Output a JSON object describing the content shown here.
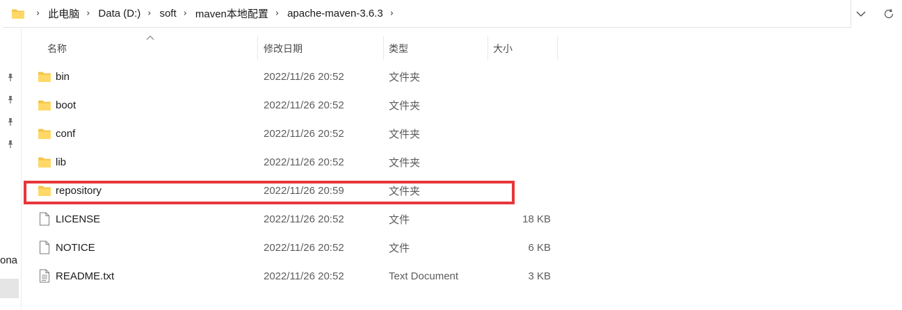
{
  "address_bar": {
    "crumbs": [
      "此电脑",
      "Data (D:)",
      "soft",
      "maven本地配置",
      "apache-maven-3.6.3"
    ]
  },
  "left_nav": {
    "partial_text": "ona"
  },
  "columns": {
    "name": "名称",
    "date": "修改日期",
    "type": "类型",
    "size": "大小"
  },
  "files": [
    {
      "name": "bin",
      "date": "2022/11/26 20:52",
      "type": "文件夹",
      "size": "",
      "icon": "folder-icon"
    },
    {
      "name": "boot",
      "date": "2022/11/26 20:52",
      "type": "文件夹",
      "size": "",
      "icon": "folder-icon"
    },
    {
      "name": "conf",
      "date": "2022/11/26 20:52",
      "type": "文件夹",
      "size": "",
      "icon": "folder-icon"
    },
    {
      "name": "lib",
      "date": "2022/11/26 20:52",
      "type": "文件夹",
      "size": "",
      "icon": "folder-icon"
    },
    {
      "name": "repository",
      "date": "2022/11/26 20:59",
      "type": "文件夹",
      "size": "",
      "icon": "folder-icon"
    },
    {
      "name": "LICENSE",
      "date": "2022/11/26 20:52",
      "type": "文件",
      "size": "18 KB",
      "icon": "file-icon"
    },
    {
      "name": "NOTICE",
      "date": "2022/11/26 20:52",
      "type": "文件",
      "size": "6 KB",
      "icon": "file-icon"
    },
    {
      "name": "README.txt",
      "date": "2022/11/26 20:52",
      "type": "Text Document",
      "size": "3 KB",
      "icon": "text-file-icon"
    }
  ],
  "highlight_color": "#e8363a",
  "folder_color": "#f5c54a"
}
